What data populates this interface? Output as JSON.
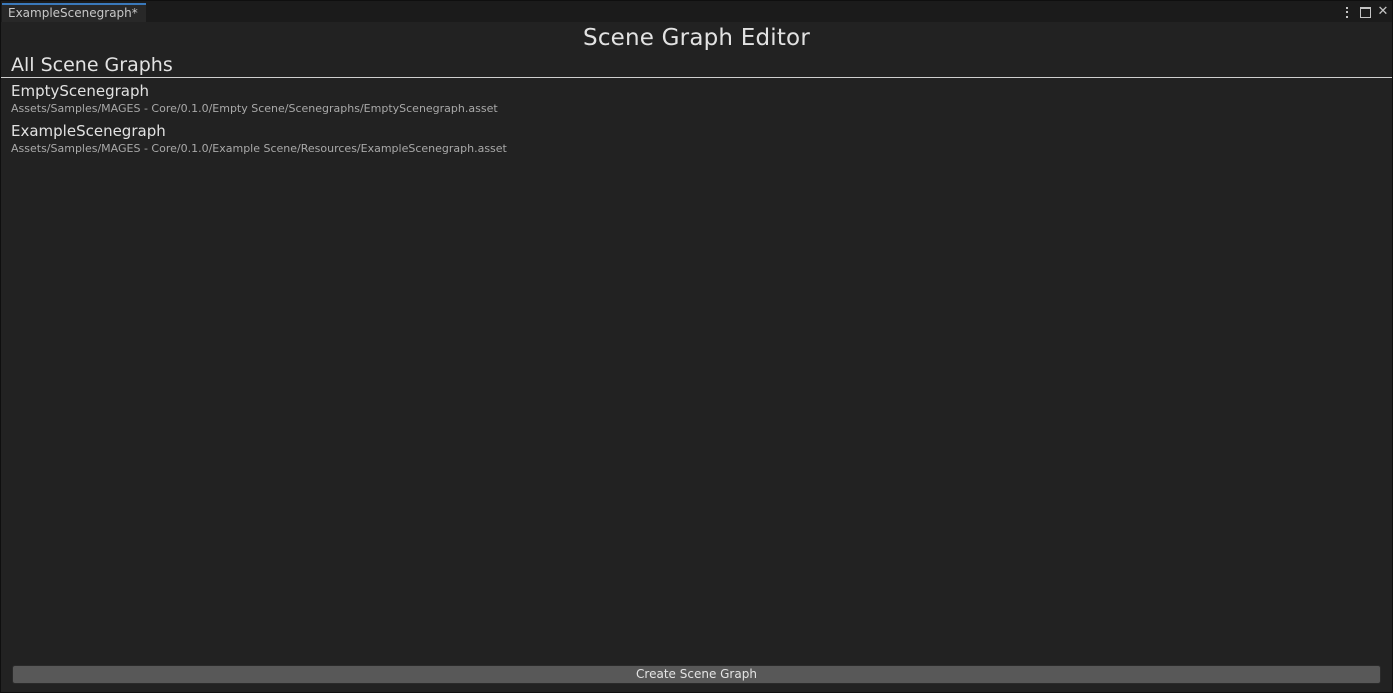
{
  "window": {
    "tab_label": "ExampleScenegraph*",
    "controls": {
      "menu_icon": "kebab-menu-icon",
      "maximize_icon": "maximize-icon",
      "close_icon": "close-icon",
      "close_glyph": "✕"
    }
  },
  "main": {
    "title": "Scene Graph Editor",
    "section_title": "All Scene Graphs",
    "graphs": [
      {
        "name": "EmptyScenegraph",
        "path": "Assets/Samples/MAGES - Core/0.1.0/Empty Scene/Scenegraphs/EmptyScenegraph.asset"
      },
      {
        "name": "ExampleScenegraph",
        "path": "Assets/Samples/MAGES - Core/0.1.0/Example Scene/Resources/ExampleScenegraph.asset"
      }
    ],
    "create_button_label": "Create Scene Graph"
  },
  "colors": {
    "background": "#222222",
    "tab_accent": "#3a79bb",
    "button": "#585858",
    "divider": "#cfcfcf"
  }
}
